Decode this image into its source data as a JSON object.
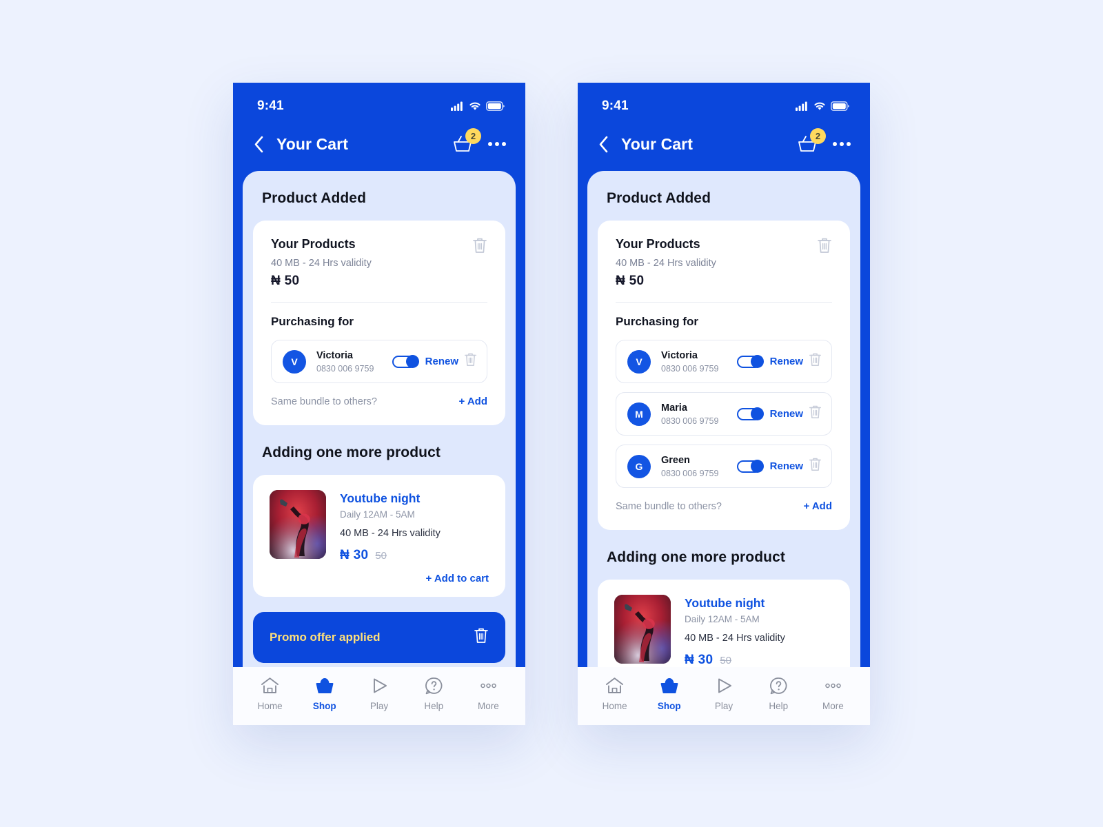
{
  "theme": {
    "brand_blue": "#0b47dc",
    "accent_blue": "#0f52e0",
    "badge_yellow": "#ffd95e",
    "promo_text_yellow": "#ffe07a",
    "page_background": "#edf2fe",
    "sheet_background": "#dfe8fd",
    "card_background": "#ffffff",
    "muted_text": "#8b92a4"
  },
  "status_bar": {
    "time": "9:41",
    "signal_icon": "cellular-signal-icon",
    "wifi_icon": "wifi-icon",
    "battery_icon": "battery-icon"
  },
  "appbar": {
    "back_icon": "chevron-left-icon",
    "title": "Your Cart",
    "cart_icon": "shopping-basket-icon",
    "cart_badge": "2",
    "overflow_icon": "more-horizontal-icon"
  },
  "sheet": {
    "title": "Product Added"
  },
  "product": {
    "title": "Your Products",
    "spec": "40 MB - 24 Hrs validity",
    "price": "₦ 50",
    "delete_icon": "trash-icon"
  },
  "purchasing": {
    "label": "Purchasing for",
    "bundle_question": "Same bundle to others?",
    "add_label": "+ Add",
    "renew_label": "Renew",
    "toggle_icon": "toggle-on-icon",
    "delete_icon": "trash-icon"
  },
  "screens": [
    {
      "id": "single-recipient",
      "contacts": [
        {
          "initial": "V",
          "name": "Victoria",
          "phone": "0830 006 9759",
          "renew": "Renew"
        }
      ]
    },
    {
      "id": "multiple-recipients",
      "contacts": [
        {
          "initial": "V",
          "name": "Victoria",
          "phone": "0830 006 9759",
          "renew": "Renew"
        },
        {
          "initial": "M",
          "name": "Maria",
          "phone": "0830 006 9759",
          "renew": "Renew"
        },
        {
          "initial": "G",
          "name": "Green",
          "phone": "0830 006 9759",
          "renew": "Renew"
        }
      ]
    }
  ],
  "upsell": {
    "heading": "Adding one more product",
    "name": "Youtube night",
    "schedule": "Daily 12AM - 5AM",
    "spec": "40 MB - 24 Hrs validity",
    "price_new": "₦ 30",
    "price_old": "50",
    "add_to_cart": "+ Add to cart",
    "thumbnail_icon": "dancer-photo"
  },
  "promo_banner": {
    "text": "Promo offer applied",
    "delete_icon": "trash-icon"
  },
  "bottom_nav": {
    "items": [
      {
        "label": "Home",
        "icon": "home-icon",
        "active": false
      },
      {
        "label": "Shop",
        "icon": "basket-icon",
        "active": true
      },
      {
        "label": "Play",
        "icon": "play-icon",
        "active": false
      },
      {
        "label": "Help",
        "icon": "help-icon",
        "active": false
      },
      {
        "label": "More",
        "icon": "more-icon",
        "active": false
      }
    ]
  }
}
